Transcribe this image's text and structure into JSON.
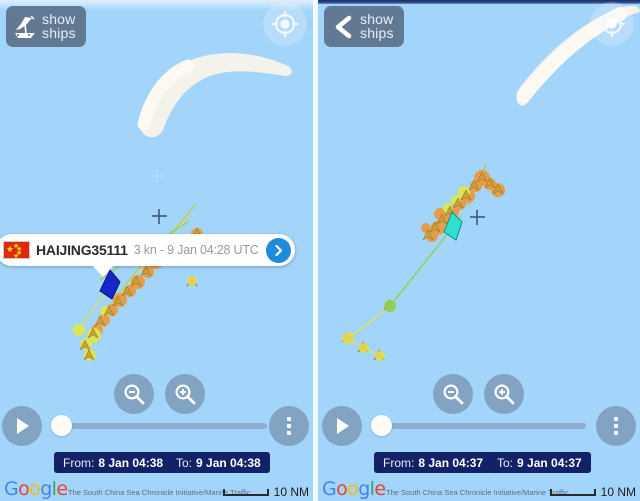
{
  "app": {
    "title": "Marine Traffic ship tracker",
    "sea_color": "#a3d4fa",
    "land_color": "#f7f4ea",
    "chip_color": "#132266",
    "accent_blue": "#1f8bdb"
  },
  "panels": [
    {
      "id": "left",
      "show_ships": {
        "icon": "ship-icon",
        "line1": "show",
        "line2": "ships"
      },
      "gps_button": {
        "icon": "gps-target-icon",
        "label": "Locate me"
      },
      "callout": {
        "visible": true,
        "flag": "flag-china",
        "flag_icon": "china-flag-icon",
        "vessel_name": "HAIJING35111",
        "meta": "3 kn - 9 Jan 04:28 UTC",
        "speed": "3 kn",
        "timestamp": "9 Jan 04:28 UTC",
        "detail_icon": "chevron-right-icon"
      },
      "controls": {
        "zoom_out_icon": "magnifier-minus-icon",
        "zoom_in_icon": "magnifier-plus-icon",
        "play_icon": "play-icon",
        "menu_icon": "kebab-menu-icon",
        "slider_position_percent": 0
      },
      "chips": {
        "from_label": "From:",
        "from_value": "8 Jan 04:38",
        "to_label": "To:",
        "to_value": "9 Jan 04:38"
      },
      "attribution": {
        "google": "Google",
        "credit": "The South China Sea Chronicle Initiative/Marine Traffic",
        "scale": "10 NM"
      }
    },
    {
      "id": "right",
      "show_ships": {
        "icon": "chevron-left-icon",
        "line1": "show",
        "line2": "ships"
      },
      "gps_button": {
        "icon": "gps-target-icon",
        "label": "Locate me"
      },
      "callout": {
        "visible": false
      },
      "controls": {
        "zoom_out_icon": "magnifier-minus-icon",
        "zoom_in_icon": "magnifier-plus-icon",
        "play_icon": "play-icon",
        "menu_icon": "kebab-menu-icon",
        "slider_position_percent": 0
      },
      "chips": {
        "from_label": "From:",
        "from_value": "8 Jan 04:37",
        "to_label": "To:",
        "to_value": "9 Jan 04:37"
      },
      "attribution": {
        "google": "Google",
        "credit": "The South China Sea Chronicle Initiative/Marine Traffic",
        "scale": "10 NM"
      }
    }
  ],
  "map_markers": {
    "selected_left_color": "#1626c8",
    "selected_right_color": "#2fe0d0",
    "vessel_colors": [
      "#f0a14a",
      "#e88b34",
      "#e4d24a",
      "#d9ea5c",
      "#8fd94a"
    ],
    "track_colors": [
      "#7cc24a",
      "#cfe05a",
      "#e0e24a"
    ],
    "crosshair_color": "#3c5a78"
  }
}
